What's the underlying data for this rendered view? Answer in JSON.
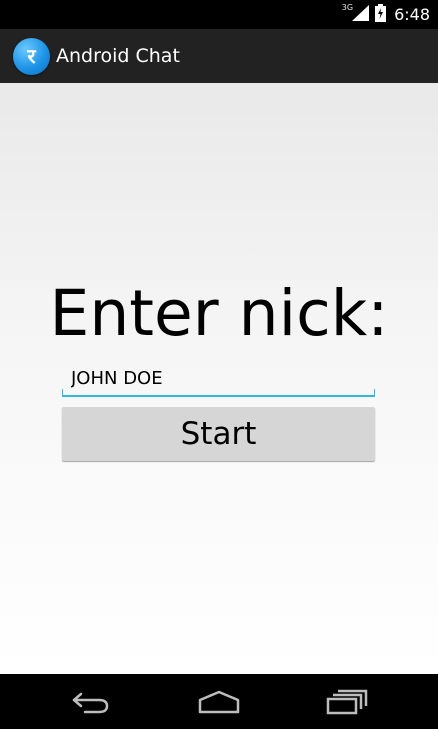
{
  "status_bar": {
    "network_type": "3G",
    "time": "6:48",
    "icons": [
      "signal-icon",
      "battery-icon"
    ]
  },
  "action_bar": {
    "app_icon_glyph": "र",
    "title": "Android Chat"
  },
  "main": {
    "heading": "Enter nick:",
    "nick_input": {
      "value": "JOHN DOE",
      "placeholder": ""
    },
    "start_button_label": "Start"
  },
  "nav_bar": {
    "buttons": [
      "back-icon",
      "home-icon",
      "recent-apps-icon"
    ]
  },
  "colors": {
    "accent": "#33b5e5",
    "action_bar": "#222222",
    "button": "#d6d6d6"
  }
}
